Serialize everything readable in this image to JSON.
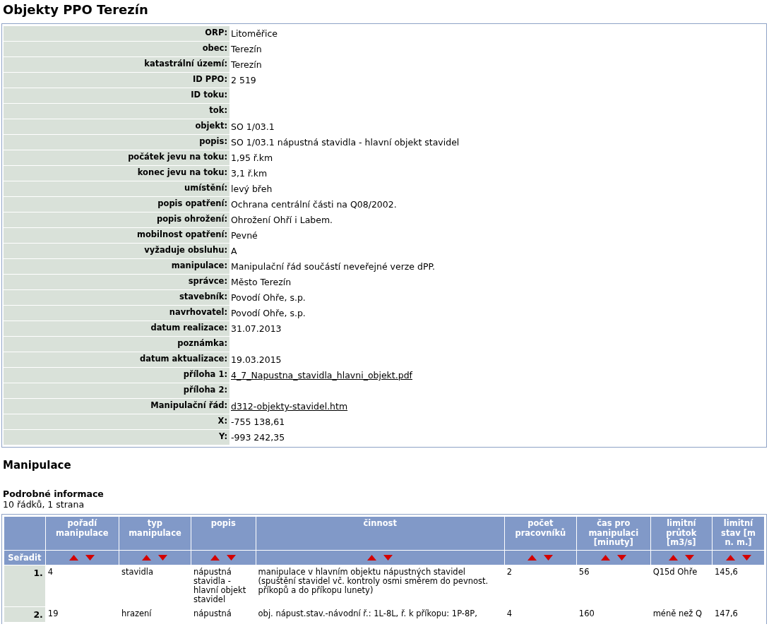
{
  "title": "Objekty PPO Terezín",
  "details": [
    {
      "label": "ORP:",
      "value": "Litoměřice",
      "kind": "text"
    },
    {
      "label": "obec:",
      "value": "Terezín",
      "kind": "text"
    },
    {
      "label": "katastrální území:",
      "value": "Terezín",
      "kind": "text"
    },
    {
      "label": "ID PPO:",
      "value": "2 519",
      "kind": "text"
    },
    {
      "label": "ID toku:"
    },
    {
      "label": "tok:"
    },
    {
      "label": "objekt:",
      "value": "SO 1/03.1",
      "kind": "text"
    },
    {
      "label": "popis:",
      "value": "SO 1/03.1 nápustná stavidla - hlavní objekt stavidel",
      "kind": "text"
    },
    {
      "label": "počátek jevu na toku:",
      "value": "1,95 ř.km",
      "kind": "text"
    },
    {
      "label": "konec jevu na toku:",
      "value": "3,1 ř.km",
      "kind": "text"
    },
    {
      "label": "umístění:",
      "value": "levý břeh",
      "kind": "text"
    },
    {
      "label": "popis opatření:",
      "value": "Ochrana centrální části na Q08/2002.",
      "kind": "text"
    },
    {
      "label": "popis ohrožení:",
      "value": "Ohrožení Ohří i Labem.",
      "kind": "text"
    },
    {
      "label": "mobilnost opatření:",
      "value": "Pevné",
      "kind": "text"
    },
    {
      "label": "vyžaduje obsluhu:",
      "value": "A",
      "kind": "text"
    },
    {
      "label": "manipulace:",
      "value": "Manipulační řád součástí neveřejné verze dPP.",
      "kind": "text"
    },
    {
      "label": "správce:",
      "value": "Město Terezín",
      "kind": "text"
    },
    {
      "label": "stavebník:",
      "value": "Povodí Ohře, s.p.",
      "kind": "text"
    },
    {
      "label": "navrhovatel:",
      "value": "Povodí Ohře, s.p.",
      "kind": "text"
    },
    {
      "label": "datum realizace:",
      "value": "31.07.2013",
      "kind": "text"
    },
    {
      "label": "poznámka:"
    },
    {
      "label": "datum aktualizace:",
      "value": "19.03.2015",
      "kind": "text"
    },
    {
      "label": "příloha 1:",
      "value": "4_7_Napustna_stavidla_hlavni_objekt.pdf",
      "kind": "link"
    },
    {
      "label": "příloha 2:"
    },
    {
      "label": "Manipulační řád:",
      "value": "d312-objekty-stavidel.htm",
      "kind": "link"
    },
    {
      "label": "X:",
      "value": "-755 138,61",
      "kind": "text"
    },
    {
      "label": "Y:",
      "value": "-993 242,35",
      "kind": "text"
    }
  ],
  "section_title": "Manipulace",
  "subsection_title": "Podrobné informace",
  "summary": "10 řádků, 1 strana",
  "table": {
    "sort_label": "Seřadit",
    "columns": [
      "pořadí manipulace",
      "typ manipulace",
      "popis",
      "činnost",
      "počet pracovníků",
      "čas pro manipulaci [minuty]",
      "limitní průtok [m3/s]",
      "limitní stav [m n. m.]"
    ],
    "rows": [
      {
        "number": "1.",
        "cells": [
          "4",
          "stavidla",
          "nápustná stavidla - hlavní objekt stavidel",
          "manipulace v hlavním objektu nápustných stavidel (spuštění stavidel vč. kontroly osmi směrem do pevnost. příkopů a do příkopu lunety)",
          "2",
          "56",
          "Q15d Ohře",
          "145,6"
        ]
      },
      {
        "number": "2.",
        "cells": [
          "19",
          "hrazení",
          "nápustná",
          "obj. nápust.stav.-návodní ř.: 1L-8L, ř. k příkopu: 1P-8P,",
          "4",
          "160",
          "méně než Q",
          "147,6"
        ]
      }
    ]
  }
}
